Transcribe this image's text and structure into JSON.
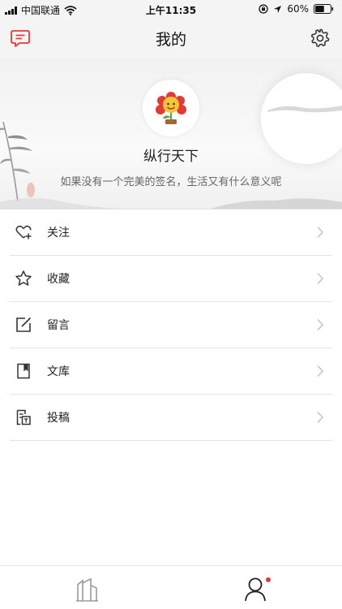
{
  "status_bar": {
    "carrier": "中国联通",
    "time": "上午11:35",
    "battery_percent": "60%",
    "battery_level": 0.6
  },
  "nav": {
    "title": "我的",
    "left_icon": "message-icon",
    "right_icon": "gear-icon"
  },
  "profile": {
    "nickname": "纵行天下",
    "signature": "如果没有一个完美的签名，生活又有什么意义呢"
  },
  "menu": {
    "items": [
      {
        "label": "关注",
        "icon": "heart-plus-icon"
      },
      {
        "label": "收藏",
        "icon": "star-icon"
      },
      {
        "label": "留言",
        "icon": "edit-icon"
      },
      {
        "label": "文库",
        "icon": "book-icon"
      },
      {
        "label": "投稿",
        "icon": "submit-icon"
      }
    ]
  },
  "tab_bar": {
    "tabs": [
      {
        "icon": "home-icon",
        "active": false
      },
      {
        "icon": "user-icon",
        "active": true,
        "badge": true
      }
    ]
  },
  "colors": {
    "accent": "#e53935",
    "divider": "#e4e4e4",
    "text": "#222222"
  }
}
